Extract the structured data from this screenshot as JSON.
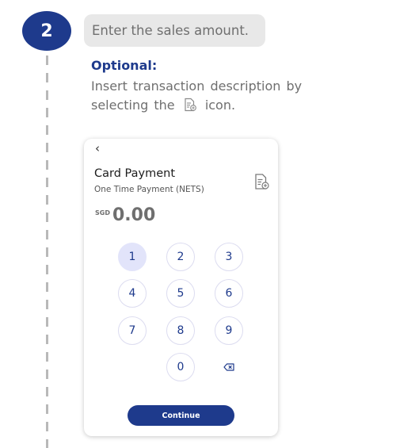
{
  "step": {
    "number": "2",
    "instruction": "Enter the sales amount.",
    "optional_label": "Optional:",
    "optional_text_before": "Insert transaction description by selecting the",
    "optional_text_after": "icon."
  },
  "card": {
    "back_glyph": "‹",
    "title": "Card Payment",
    "subtitle": "One Time Payment (NETS)",
    "currency": "SGD",
    "amount": "0.00",
    "keys": [
      "1",
      "2",
      "3",
      "4",
      "5",
      "6",
      "7",
      "8",
      "9",
      "0"
    ],
    "continue_label": "Continue"
  },
  "icons": {
    "description": "document-edit-icon",
    "backspace": "backspace-icon"
  },
  "colors": {
    "primary": "#1e3a8c",
    "active_key": "#e2e4fa",
    "muted_text": "#6f6f6f"
  }
}
